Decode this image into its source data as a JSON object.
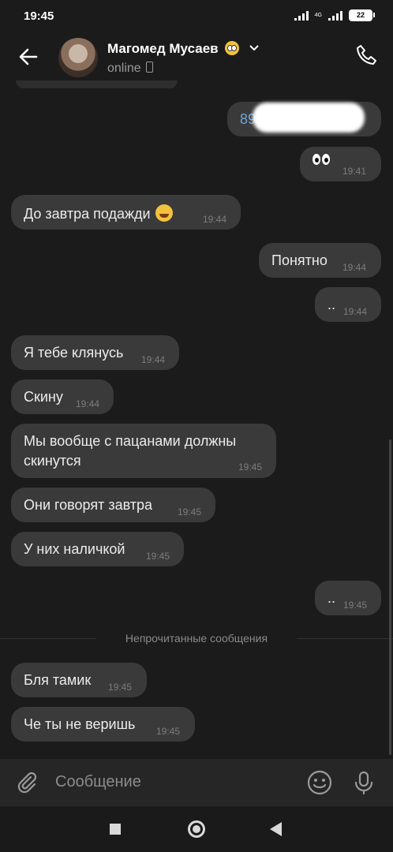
{
  "status_bar": {
    "time": "19:45",
    "network": "4G",
    "battery": "22"
  },
  "header": {
    "contact_name": "Магомед Мусаев",
    "status": "online",
    "emoji": "flushed-face"
  },
  "messages": [
    {
      "side": "out",
      "text": "89",
      "time": "",
      "redacted": true
    },
    {
      "side": "out",
      "text": "",
      "time": "19:41",
      "emoji": "eyes"
    },
    {
      "side": "in",
      "text": "До завтра подажди",
      "time": "19:44",
      "emoji": "laughing-face"
    },
    {
      "side": "out",
      "text": "Понятно",
      "time": "19:44"
    },
    {
      "side": "out",
      "text": "..",
      "time": "19:44"
    },
    {
      "side": "in",
      "text": "Я тебе клянусь",
      "time": "19:44"
    },
    {
      "side": "in",
      "text": "Скину",
      "time": "19:44"
    },
    {
      "side": "in",
      "text": "Мы вообще с пацанами должны",
      "text2": "скинутся",
      "time": "19:45"
    },
    {
      "side": "in",
      "text": "Они говорят завтра",
      "time": "19:45"
    },
    {
      "side": "in",
      "text": "У них наличкой",
      "time": "19:45"
    },
    {
      "side": "out",
      "text": "..",
      "time": "19:45"
    },
    {
      "side": "in",
      "text": "Бля тамик",
      "time": "19:45"
    },
    {
      "side": "in",
      "text": "Че ты не веришь",
      "time": "19:45"
    }
  ],
  "unread_divider": "Непрочитанные сообщения",
  "composer": {
    "placeholder": "Сообщение"
  },
  "colors": {
    "bubble": "#3a3a3a",
    "background": "#1b1b1b",
    "link": "#6ea4d8"
  }
}
